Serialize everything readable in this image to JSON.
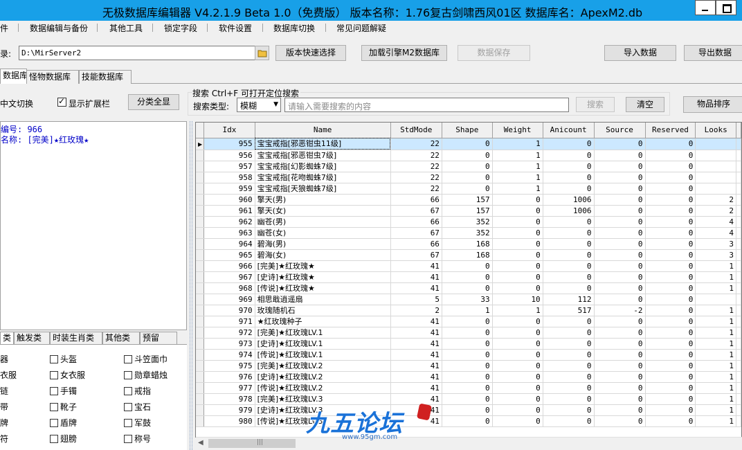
{
  "window": {
    "title": "无极数据库编辑器 V4.2.1.9   Beta 1.0（免费版）   版本名称：1.76复古剑啸西风01区   数据库名：ApexM2.db"
  },
  "menu": [
    "件",
    "数据编辑与备份",
    "其他工具",
    "锁定字段",
    "软件设置",
    "数据库切换",
    "常见问题解疑"
  ],
  "toolbar": {
    "dir_label": "录:",
    "dir_value": "D:\\MirServer2",
    "quick_select": "版本快速选择",
    "load_engine": "加载引擎M2数据库",
    "save_data": "数据保存",
    "import_data": "导入数据",
    "export_data": "导出数据"
  },
  "tabs": [
    "数据库",
    "怪物数据库",
    "技能数据库"
  ],
  "options": {
    "lang_switch": "中文切换",
    "show_ext": "显示扩展栏",
    "show_ext_checked": true,
    "classify_all": "分类全显",
    "search_title": "搜索   Ctrl+F 可打开定位搜索",
    "search_type_label": "搜索类型:",
    "search_type_value": "模糊",
    "search_placeholder": "请输入需要搜索的内容",
    "search_button": "搜索",
    "clear_button": "清空",
    "sort_button": "物品排序"
  },
  "info": {
    "id_line": "编号: 966",
    "name_line": "名称: [完美]★红玫瑰★"
  },
  "category_tabs": [
    "类",
    "触发类",
    "时装生肖类",
    "其他类",
    "预留"
  ],
  "category_items": [
    [
      "器",
      "头盔",
      "斗笠面巾"
    ],
    [
      "衣服",
      "女衣服",
      "勋章蜡烛"
    ],
    [
      "链",
      "手镯",
      "戒指"
    ],
    [
      "带",
      "靴子",
      "宝石"
    ],
    [
      "牌",
      "盾牌",
      "军鼓"
    ],
    [
      "符",
      "翅膀",
      "称号"
    ]
  ],
  "grid": {
    "columns": [
      "Idx",
      "Name",
      "StdMode",
      "Shape",
      "Weight",
      "Anicount",
      "Source",
      "Reserved",
      "Looks"
    ],
    "rows": [
      [
        "955",
        "宝宝戒指[邪恶钳虫11级]",
        "22",
        "0",
        "1",
        "0",
        "0",
        "0",
        ""
      ],
      [
        "956",
        "宝宝戒指[邪恶钳虫7级]",
        "22",
        "0",
        "1",
        "0",
        "0",
        "0",
        ""
      ],
      [
        "957",
        "宝宝戒指[幻影蜘蛛7级]",
        "22",
        "0",
        "1",
        "0",
        "0",
        "0",
        ""
      ],
      [
        "958",
        "宝宝戒指[花吻蜘蛛7级]",
        "22",
        "0",
        "1",
        "0",
        "0",
        "0",
        ""
      ],
      [
        "959",
        "宝宝戒指[天狼蜘蛛7级]",
        "22",
        "0",
        "1",
        "0",
        "0",
        "0",
        ""
      ],
      [
        "960",
        "擎天(男)",
        "66",
        "157",
        "0",
        "1006",
        "0",
        "0",
        "2"
      ],
      [
        "961",
        "擎天(女)",
        "67",
        "157",
        "0",
        "1006",
        "0",
        "0",
        "2"
      ],
      [
        "962",
        "幽苍(男)",
        "66",
        "352",
        "0",
        "0",
        "0",
        "0",
        "4"
      ],
      [
        "963",
        "幽苍(女)",
        "67",
        "352",
        "0",
        "0",
        "0",
        "0",
        "4"
      ],
      [
        "964",
        "碧海(男)",
        "66",
        "168",
        "0",
        "0",
        "0",
        "0",
        "3"
      ],
      [
        "965",
        "碧海(女)",
        "67",
        "168",
        "0",
        "0",
        "0",
        "0",
        "3"
      ],
      [
        "966",
        "[完美]★红玫瑰★",
        "41",
        "0",
        "0",
        "0",
        "0",
        "0",
        "1"
      ],
      [
        "967",
        "[史诗]★红玫瑰★",
        "41",
        "0",
        "0",
        "0",
        "0",
        "0",
        "1"
      ],
      [
        "968",
        "[传说]★红玫瑰★",
        "41",
        "0",
        "0",
        "0",
        "0",
        "0",
        "1"
      ],
      [
        "969",
        "相思戢逍遥扇",
        "5",
        "33",
        "10",
        "112",
        "0",
        "0",
        ""
      ],
      [
        "970",
        "玫瑰随机石",
        "2",
        "1",
        "1",
        "517",
        "-2",
        "0",
        "1"
      ],
      [
        "971",
        "★红玫瑰种子",
        "41",
        "0",
        "0",
        "0",
        "0",
        "0",
        "1"
      ],
      [
        "972",
        "[完美]★红玫瑰LV.1",
        "41",
        "0",
        "0",
        "0",
        "0",
        "0",
        "1"
      ],
      [
        "973",
        "[史诗]★红玫瑰LV.1",
        "41",
        "0",
        "0",
        "0",
        "0",
        "0",
        "1"
      ],
      [
        "974",
        "[传说]★红玫瑰LV.1",
        "41",
        "0",
        "0",
        "0",
        "0",
        "0",
        "1"
      ],
      [
        "975",
        "[完美]★红玫瑰LV.2",
        "41",
        "0",
        "0",
        "0",
        "0",
        "0",
        "1"
      ],
      [
        "976",
        "[史诗]★红玫瑰LV.2",
        "41",
        "0",
        "0",
        "0",
        "0",
        "0",
        "1"
      ],
      [
        "977",
        "[传说]★红玫瑰LV.2",
        "41",
        "0",
        "0",
        "0",
        "0",
        "0",
        "1"
      ],
      [
        "978",
        "[完美]★红玫瑰LV.3",
        "41",
        "0",
        "0",
        "0",
        "0",
        "0",
        "1"
      ],
      [
        "979",
        "[史诗]★红玫瑰LV.3",
        "41",
        "0",
        "0",
        "0",
        "0",
        "0",
        "1"
      ],
      [
        "980",
        "[传说]★红玫瑰LV.3",
        "41",
        "0",
        "0",
        "0",
        "0",
        "0",
        "1"
      ]
    ],
    "selected_index": 0
  },
  "watermark": {
    "text": "九五论坛",
    "url": "www.95gm.com"
  },
  "colors": {
    "titlebar": "#18a0e8",
    "info_text": "#0000c8",
    "watermark": "#1a72d8"
  }
}
